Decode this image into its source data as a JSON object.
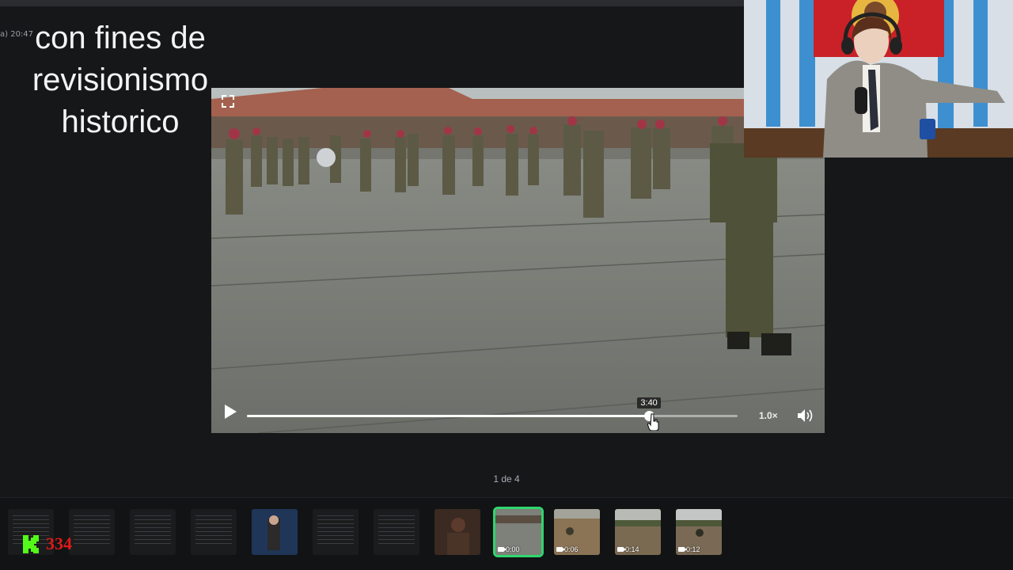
{
  "overlay": {
    "timestamp": "a) 20:47",
    "caption_lines": [
      "con fines de",
      "revisionismo",
      "historico"
    ]
  },
  "player": {
    "hover_time": "3:40",
    "speed": "1.0×",
    "progress_fraction": 0.82,
    "icons": [
      "fullscreen-icon",
      "play-icon",
      "volume-icon"
    ]
  },
  "gallery": {
    "pager": "1 de 4",
    "thumbnails": [
      {
        "kind": "document",
        "duration": ""
      },
      {
        "kind": "document",
        "duration": ""
      },
      {
        "kind": "document",
        "duration": ""
      },
      {
        "kind": "document",
        "duration": ""
      },
      {
        "kind": "image",
        "duration": ""
      },
      {
        "kind": "document",
        "duration": ""
      },
      {
        "kind": "document",
        "duration": ""
      },
      {
        "kind": "image",
        "duration": ""
      },
      {
        "kind": "video",
        "duration": "0:00",
        "active": true
      },
      {
        "kind": "video",
        "duration": "0:06"
      },
      {
        "kind": "video",
        "duration": "0:14"
      },
      {
        "kind": "video",
        "duration": "0:12"
      }
    ]
  },
  "stream": {
    "viewer_count": "334",
    "platform_icon": "kick-logo-icon",
    "colors": {
      "accent": "#2fd66e",
      "viewer_count": "#e01919",
      "background": "#151719"
    }
  }
}
